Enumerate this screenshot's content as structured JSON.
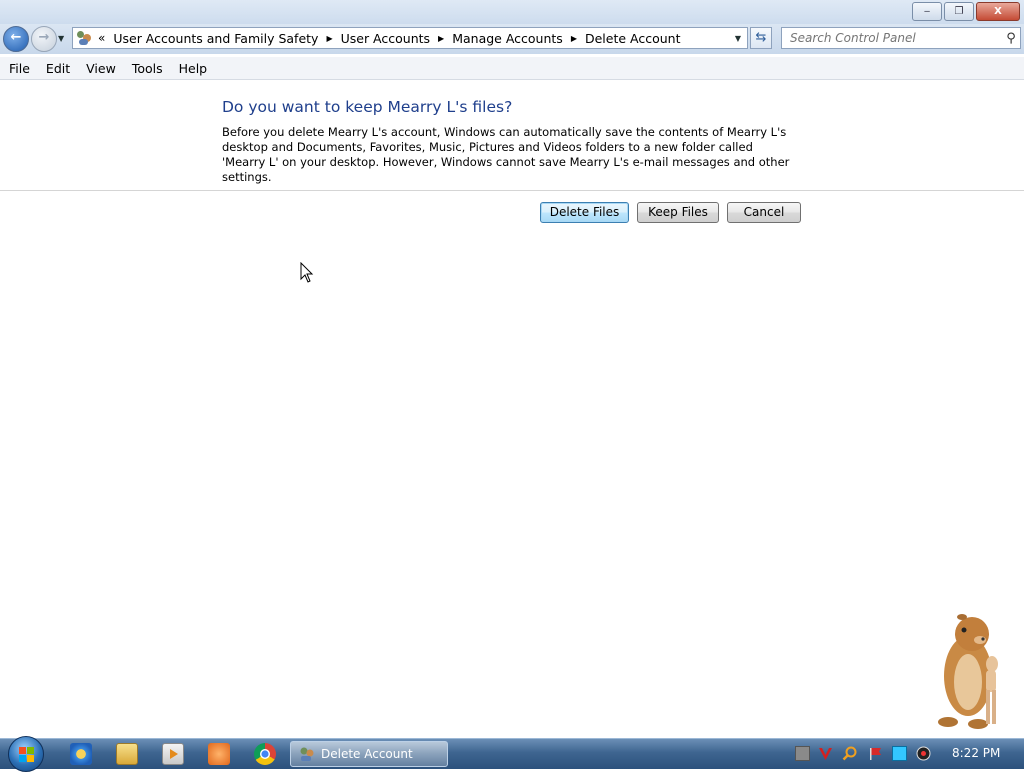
{
  "window": {
    "minimize_glyph": "‒",
    "restore_glyph": "❐",
    "close_glyph": "X"
  },
  "nav": {
    "back_glyph": "←",
    "forward_glyph": "→",
    "recent_glyph": "▼",
    "breadcrumb_overflow": "«",
    "breadcrumbs": [
      "User Accounts and Family Safety",
      "User Accounts",
      "Manage Accounts",
      "Delete Account"
    ],
    "breadcrumb_separator": "▶",
    "address_dropdown_glyph": "▼",
    "refresh_glyph": "⇆",
    "search_placeholder": "Search Control Panel",
    "search_icon_glyph": "⚲"
  },
  "menu": [
    "File",
    "Edit",
    "View",
    "Tools",
    "Help"
  ],
  "dialog": {
    "title": "Do you want to keep Mearry L's files?",
    "body": "Before you delete Mearry L's account, Windows can automatically save the contents of Mearry L's desktop and Documents, Favorites, Music, Pictures and Videos folders to a new folder called 'Mearry L' on your desktop. However, Windows cannot save Mearry L's e-mail messages and other settings.",
    "buttons": {
      "delete_files": "Delete Files",
      "keep_files": "Keep Files",
      "cancel": "Cancel"
    }
  },
  "taskbar": {
    "active_task": "Delete Account",
    "clock": "8:22 PM"
  },
  "colors": {
    "title_blue": "#1f3f8c",
    "taskbar_top": "#6b8fb6",
    "taskbar_bottom": "#2c517c"
  }
}
